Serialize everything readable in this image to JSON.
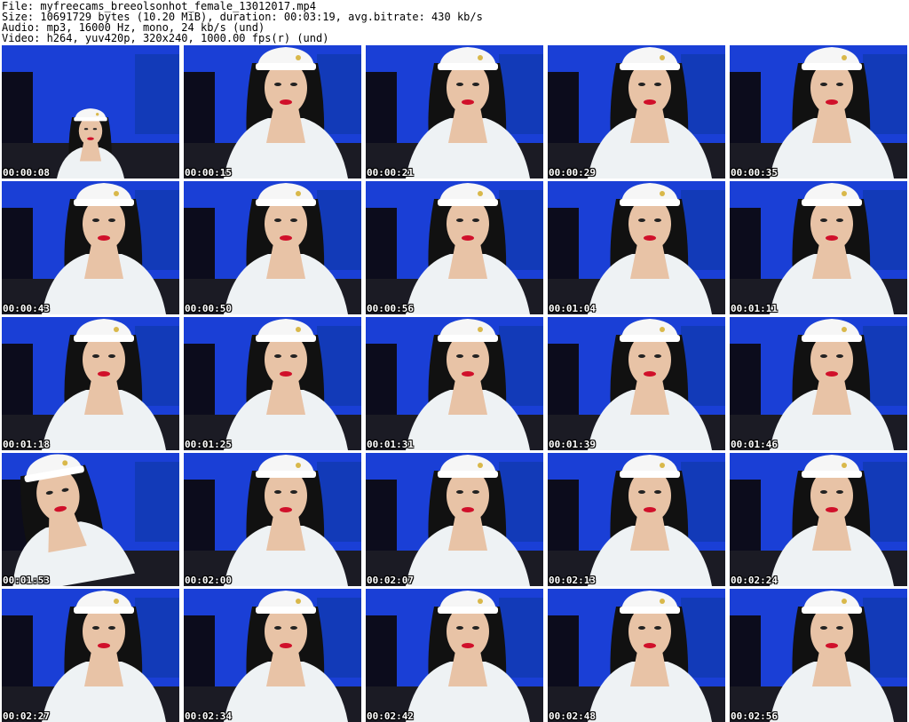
{
  "header": {
    "file_line": "File: myfreecams_breeolsonhot_female_13012017.mp4",
    "size_line": "Size: 10691729 bytes (10.20 MiB), duration: 00:03:19, avg.bitrate: 430 kb/s",
    "audio_line": "Audio: mp3, 16000 Hz, mono, 24 kb/s (und)",
    "video_line": "Video: h264, yuv420p, 320x240, 1000.00 fps(r) (und)"
  },
  "thumbnails": [
    {
      "timestamp": "00:00:08"
    },
    {
      "timestamp": "00:00:15"
    },
    {
      "timestamp": "00:00:21"
    },
    {
      "timestamp": "00:00:29"
    },
    {
      "timestamp": "00:00:35"
    },
    {
      "timestamp": "00:00:43"
    },
    {
      "timestamp": "00:00:50"
    },
    {
      "timestamp": "00:00:56"
    },
    {
      "timestamp": "00:01:04"
    },
    {
      "timestamp": "00:01:11"
    },
    {
      "timestamp": "00:01:18"
    },
    {
      "timestamp": "00:01:25"
    },
    {
      "timestamp": "00:01:31"
    },
    {
      "timestamp": "00:01:39"
    },
    {
      "timestamp": "00:01:46"
    },
    {
      "timestamp": "00:01:53"
    },
    {
      "timestamp": "00:02:00"
    },
    {
      "timestamp": "00:02:07"
    },
    {
      "timestamp": "00:02:13"
    },
    {
      "timestamp": "00:02:24"
    },
    {
      "timestamp": "00:02:27"
    },
    {
      "timestamp": "00:02:34"
    },
    {
      "timestamp": "00:02:42"
    },
    {
      "timestamp": "00:02:48"
    },
    {
      "timestamp": "00:02:56"
    }
  ],
  "colors": {
    "wall_blue": "#1a3fd6",
    "dark": "#0a0a14",
    "shirt": "#eef2f4",
    "hair": "#111111",
    "skin": "#e8c3a6",
    "lips": "#d0102a"
  }
}
